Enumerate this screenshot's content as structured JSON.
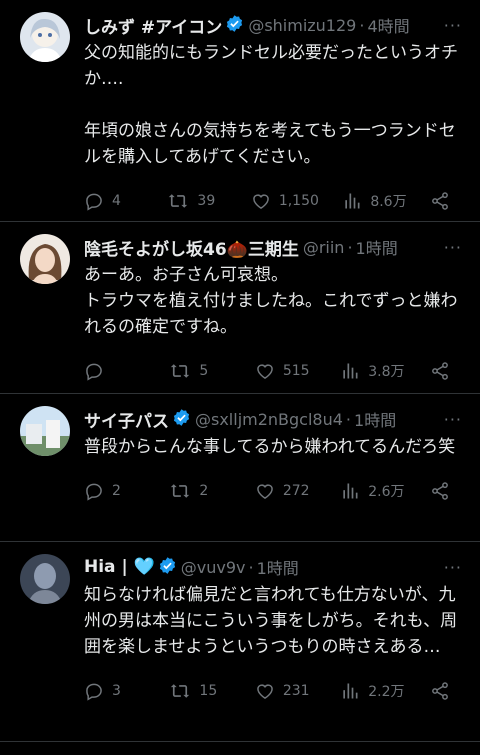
{
  "tweets": [
    {
      "name": "しみず #アイコン",
      "handle": "@shimizu129",
      "time": "4時間",
      "text": "父の知能的にもランドセル必要だったというオチか….\n\n年頃の娘さんの気持ちを考えてもう一つランドセルを購入してあげてください。",
      "replies": "4",
      "retweets": "39",
      "likes": "1,150",
      "views": "8.6万",
      "verified": true
    },
    {
      "name": "陰毛そよがし坂46🌰三期生",
      "handle": "@riin",
      "time": "1時間",
      "text": "あーあ。お子さん可哀想。\nトラウマを植え付けましたね。これでずっと嫌われるの確定ですね。",
      "replies": "",
      "retweets": "5",
      "likes": "515",
      "views": "3.8万",
      "verified": false
    },
    {
      "name": "サイ子パス",
      "handle": "@sxlljm2nBgcl8u4",
      "time": "1時間",
      "text": "普段からこんな事してるから嫌われてるんだろ笑",
      "replies": "2",
      "retweets": "2",
      "likes": "272",
      "views": "2.6万",
      "verified": true
    },
    {
      "name": "Hia | 🩵",
      "handle": "@vuv9v",
      "time": "1時間",
      "text": "知らなければ偏見だと言われても仕方ないが、九州の男は本当にこういう事をしがち。それも、周囲を楽しませようというつもりの時さえある…",
      "replies": "3",
      "retweets": "15",
      "likes": "231",
      "views": "2.2万",
      "verified": true
    }
  ],
  "separator": "·",
  "colors": {
    "background": "#000000",
    "text": "#e7e9ea",
    "muted": "#71767b",
    "verified": "#1d9bf0"
  },
  "icons": [
    "reply-icon",
    "retweet-icon",
    "like-icon",
    "views-icon",
    "share-icon",
    "verified-badge-icon",
    "more-icon"
  ]
}
